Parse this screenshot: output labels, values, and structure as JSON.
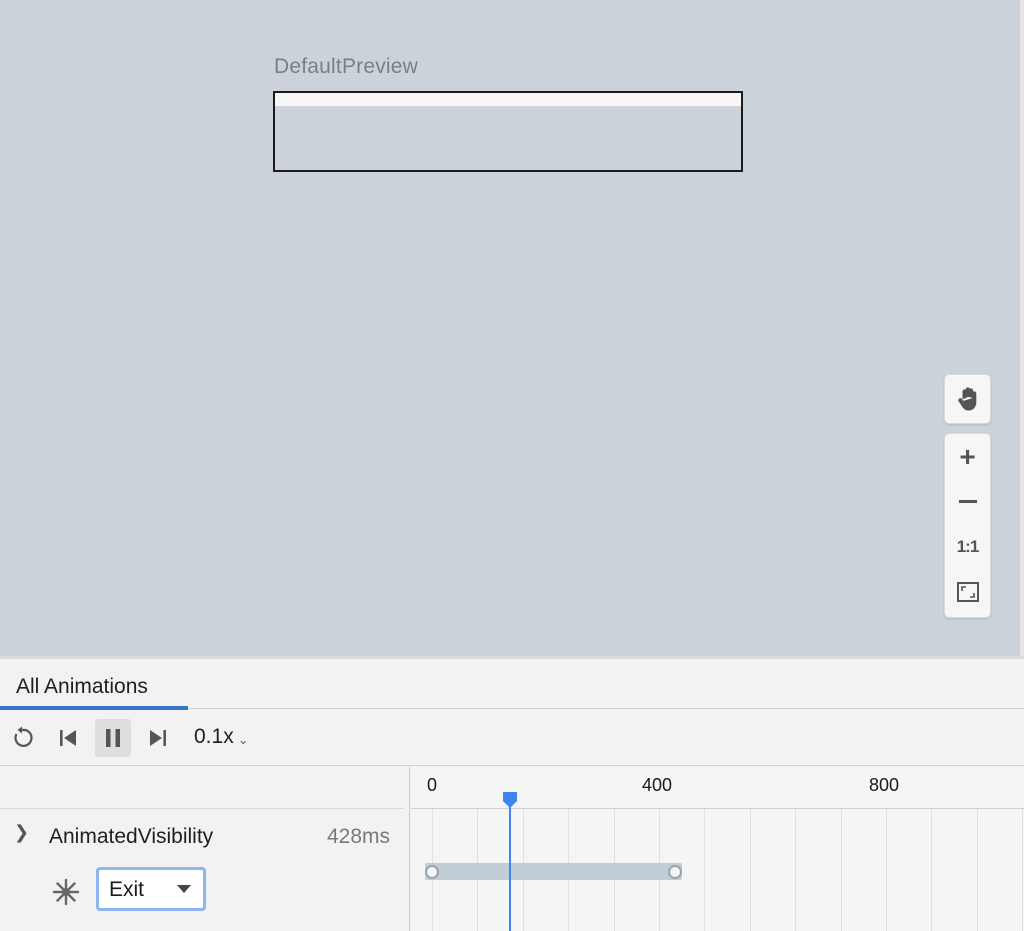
{
  "preview": {
    "label": "DefaultPreview"
  },
  "zoom_controls": {
    "pan_icon": "hand-icon",
    "zoom_in_icon": "plus-icon",
    "zoom_out_icon": "minus-icon",
    "actual_size_label": "1:1",
    "fit_icon": "fit-screen-icon"
  },
  "panel": {
    "tabs": [
      {
        "label": "All Animations",
        "active": true
      }
    ],
    "toolbar": {
      "replay_icon": "replay-icon",
      "skip_start_icon": "skip-to-start-icon",
      "pause_icon": "pause-icon",
      "skip_end_icon": "skip-to-end-icon",
      "speed": "0.1x"
    },
    "animations": [
      {
        "name": "AnimatedVisibility",
        "duration": "428ms",
        "state_icon": "freeze-icon",
        "state": "Exit"
      }
    ],
    "timeline": {
      "ticks": [
        "0",
        "400",
        "800"
      ],
      "playhead_ms": 137,
      "bar_start_ms": 0,
      "bar_end_ms": 428
    }
  },
  "colors": {
    "canvas": "#cbd2da",
    "accent": "#3774c9",
    "playhead": "#3d86ef"
  }
}
